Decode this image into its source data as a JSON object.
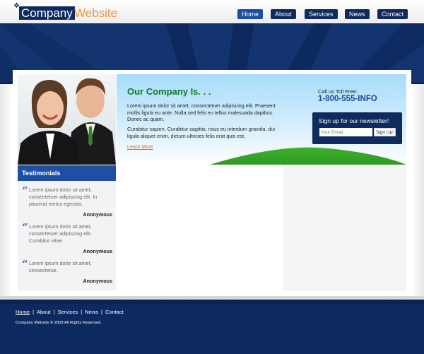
{
  "header": {
    "logo": {
      "company": "Company",
      "website": "Website"
    },
    "nav": [
      {
        "label": "Home",
        "active": true
      },
      {
        "label": "About",
        "active": false
      },
      {
        "label": "Services",
        "active": false
      },
      {
        "label": "News",
        "active": false
      },
      {
        "label": "Contact",
        "active": false
      }
    ]
  },
  "hero": {
    "title": "Our Company Is. . .",
    "paragraphs": [
      "Lorem ipsum dolor sit amet, consectetuer adipiscing elit. Praesent mollis ligula eu ante. Nulla sed felis eu tellus malesuada dapibus. Donec ac quam.",
      "Curabitur sapien. Curabitur sagittis, risus eu interdum gravida, dui ligula aliquet enim, dictum ultricies felis erat quis est."
    ],
    "learn_more": "Learn More",
    "toll_free_label": "Call us Toll Free:",
    "toll_free_number": "1-800-555-INFO",
    "newsletter": {
      "title": "Sign up for our newsletter!",
      "email_placeholder": "Your Email. . .",
      "button_label": "Sign Up!"
    }
  },
  "testimonials": {
    "title": "Testimonials",
    "items": [
      {
        "text": "Lorem ipsum dolor sit amet, consectetuer adipiscing elit. In placerat metus egestas.",
        "author": "Anonymous"
      },
      {
        "text": "Lorem ipsum dolor sit amet, consectetuer adipiscing elit. Curabitur vitae.",
        "author": "Anonymous"
      },
      {
        "text": "Lorem ipsum dolor sit amet, consectetue.",
        "author": "Anonymous"
      }
    ]
  },
  "footer": {
    "nav": [
      {
        "label": "Home",
        "active": true
      },
      {
        "label": "About",
        "active": false
      },
      {
        "label": "Services",
        "active": false
      },
      {
        "label": "News",
        "active": false
      },
      {
        "label": "Contact",
        "active": false
      }
    ],
    "copyright": "Company Website © 2009 All Rights Reserved."
  },
  "colors": {
    "navy": "#0f2a5e",
    "accent_blue": "#1f4fa3",
    "orange": "#f0942e",
    "green": "#127c22"
  }
}
